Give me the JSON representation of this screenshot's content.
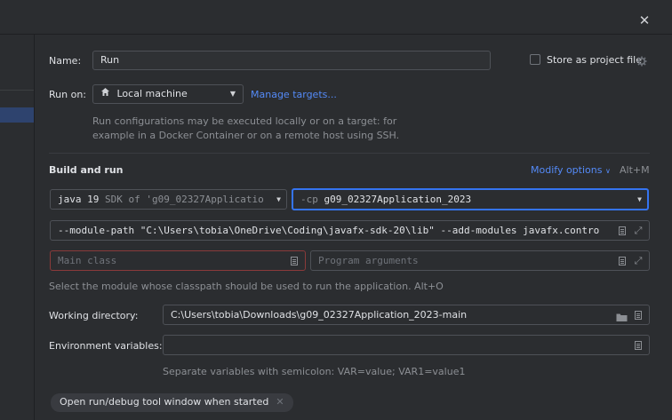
{
  "dialog": {
    "close_glyph": "✕"
  },
  "form": {
    "name_label": "Name:",
    "name_value": "Run",
    "store_project_label": "Store as project file",
    "run_on_label": "Run on:",
    "run_on_value": "Local machine",
    "manage_targets_link": "Manage targets...",
    "run_on_hint_line1": "Run configurations may be executed locally or on a target: for",
    "run_on_hint_line2": "example in a Docker Container or on a remote host using SSH.",
    "section_title": "Build and run",
    "modify_options_label": "Modify options",
    "modify_options_shortcut": "Alt+M",
    "jdk_java": "java 19",
    "jdk_rest": "SDK of 'g09_02327Applicatio",
    "cp_prefix": "-cp",
    "cp_value": "g09_02327Application_2023",
    "vm_options_value": "--module-path \"C:\\Users\\tobia\\OneDrive\\Coding\\javafx-sdk-20\\lib\" --add-modules javafx.contro",
    "main_class_placeholder": "Main class",
    "program_args_placeholder": "Program arguments",
    "module_hint": "Select the module whose classpath should be used to run the application. Alt+O",
    "working_dir_label": "Working directory:",
    "working_dir_value": "C:\\Users\\tobia\\Downloads\\g09_02327Application_2023-main",
    "env_vars_label": "Environment variables:",
    "env_vars_hint": "Separate variables with semicolon: VAR=value; VAR1=value1",
    "open_tool_window_chip": "Open run/debug tool window when started",
    "chip_close_glyph": "✕"
  },
  "colors": {
    "background": "#2b2d30",
    "accent_link": "#548af7",
    "focused_border": "#3574f0",
    "error_border": "#8a3a3a"
  },
  "icons": {
    "close": "close-icon",
    "gear": "gear-icon",
    "home": "home-icon",
    "dropdown": "chevron-down-icon",
    "expand": "expand-icon",
    "folder": "folder-icon",
    "document": "document-icon"
  }
}
